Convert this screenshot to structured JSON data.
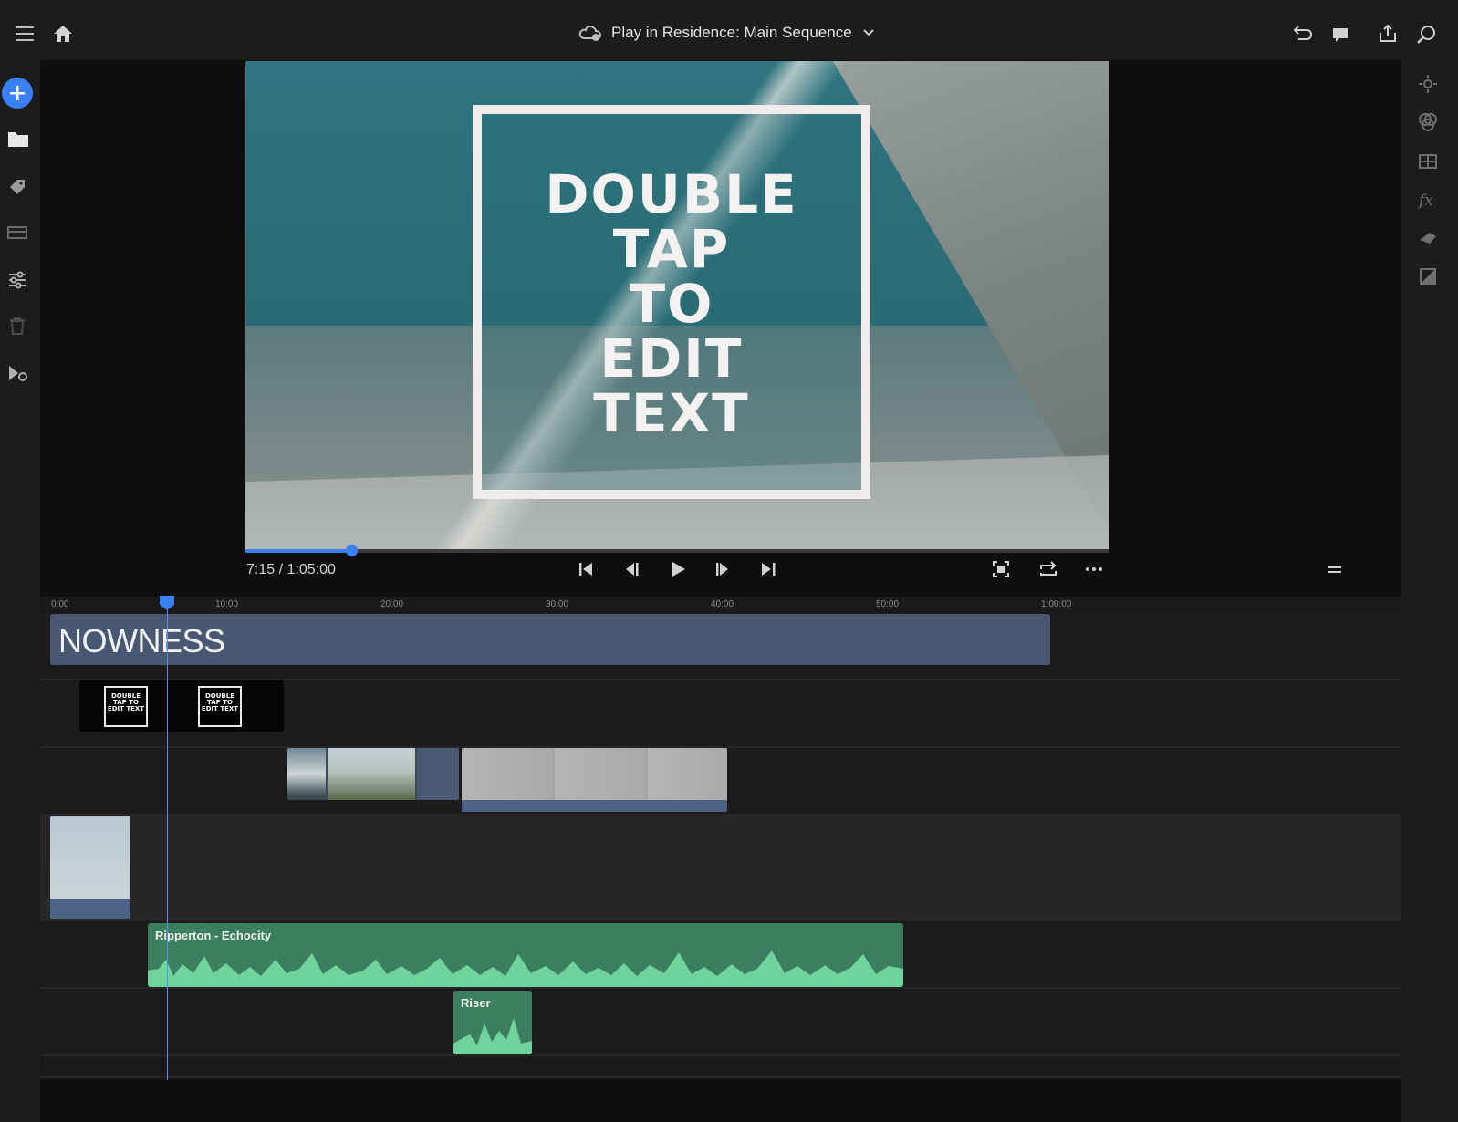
{
  "header": {
    "sequence_title": "Play in Residence: Main Sequence",
    "menu_icon": "hamburger-menu-icon",
    "home_icon": "home-icon",
    "cloud_icon": "cloud-sync-icon",
    "dropdown_icon": "chevron-down-icon",
    "undo_icon": "undo-icon",
    "comment_icon": "comment-icon",
    "share_icon": "share-icon",
    "search_icon": "search-icon"
  },
  "left_toolbar": [
    {
      "name": "add-media-button",
      "icon": "plus-icon"
    },
    {
      "name": "media-folder-button",
      "icon": "folder-icon"
    },
    {
      "name": "tag-button",
      "icon": "tag-icon"
    },
    {
      "name": "title-button",
      "icon": "title-card-icon"
    },
    {
      "name": "adjust-button",
      "icon": "sliders-icon"
    },
    {
      "name": "delete-button",
      "icon": "trash-icon"
    },
    {
      "name": "add-track-button",
      "icon": "add-track-icon"
    }
  ],
  "right_toolbar": [
    {
      "name": "properties-button",
      "icon": "properties-icon"
    },
    {
      "name": "color-button",
      "icon": "color-circles-icon"
    },
    {
      "name": "transform-button",
      "icon": "transform-icon"
    },
    {
      "name": "effects-button",
      "icon": "fx-icon"
    },
    {
      "name": "speed-button",
      "icon": "speed-icon"
    },
    {
      "name": "adjustment-button",
      "icon": "contrast-icon"
    }
  ],
  "preview": {
    "title_text": [
      "DOUBLE",
      "TAP",
      "TO",
      "EDIT",
      "TEXT"
    ],
    "timecode": "7:15 / 1:05:00",
    "scrub_progress": 0.122
  },
  "playback_controls": [
    {
      "name": "go-to-start-button",
      "icon": "skip-start-icon"
    },
    {
      "name": "step-back-button",
      "icon": "step-back-icon"
    },
    {
      "name": "play-button",
      "icon": "play-icon"
    },
    {
      "name": "step-forward-button",
      "icon": "step-forward-icon"
    },
    {
      "name": "go-to-end-button",
      "icon": "skip-end-icon"
    },
    {
      "name": "fit-button",
      "icon": "fit-screen-icon"
    },
    {
      "name": "loop-button",
      "icon": "loop-icon"
    },
    {
      "name": "more-button",
      "icon": "more-horizontal-icon"
    },
    {
      "name": "panel-menu-button",
      "icon": "equals-icon"
    }
  ],
  "timeline": {
    "ruler_labels": [
      "0:00",
      "10:00",
      "20:00",
      "30:00",
      "40:00",
      "50:00",
      "1:00:00"
    ],
    "clips": {
      "nowness_label": "NOWNESS",
      "title_clip_text": "DOUBLE TAP TO EDIT TEXT",
      "audio_track_1": "Ripperton - Echocity",
      "audio_track_2": "Riser"
    }
  },
  "colors": {
    "accent": "#3b7ff5",
    "video_clip": "#485873",
    "audio_clip": "#3b7f60",
    "waveform": "#6fd49c"
  }
}
